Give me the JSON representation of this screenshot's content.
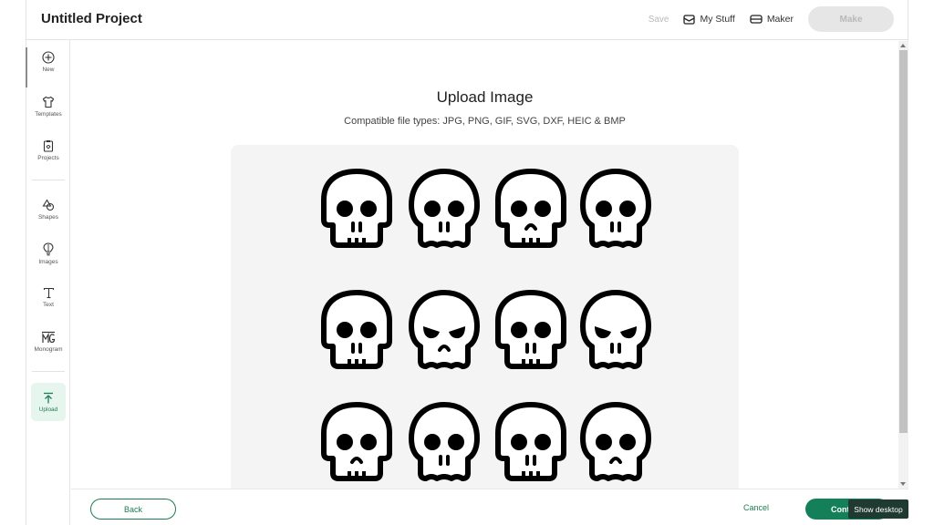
{
  "header": {
    "title": "Untitled Project",
    "save_label": "Save",
    "my_stuff_label": "My Stuff",
    "maker_label": "Maker",
    "make_label": "Make"
  },
  "sidebar": {
    "items": [
      {
        "label": "New",
        "icon": "plus-circle-icon"
      },
      {
        "label": "Templates",
        "icon": "shirt-icon"
      },
      {
        "label": "Projects",
        "icon": "clipboard-icon"
      },
      {
        "label": "Shapes",
        "icon": "shapes-icon"
      },
      {
        "label": "Images",
        "icon": "lightbulb-icon"
      },
      {
        "label": "Text",
        "icon": "text-icon"
      },
      {
        "label": "Monogram",
        "icon": "monogram-icon"
      },
      {
        "label": "Upload",
        "icon": "upload-icon",
        "active": true
      }
    ]
  },
  "main": {
    "title": "Upload Image",
    "subtitle": "Compatible file types:  JPG, PNG, GIF, SVG, DXF, HEIC & BMP",
    "preview": {
      "description": "Uploaded image preview: grid of 12 cartoon skull icons",
      "rows": 3,
      "columns": 4
    }
  },
  "footer": {
    "back_label": "Back",
    "cancel_label": "Cancel",
    "continue_label": "Cont"
  },
  "tooltip": {
    "text": "Show desktop"
  },
  "colors": {
    "accent": "#1c7d52",
    "continue_bg": "#13805a",
    "upload_active_bg": "#e6f5ee",
    "make_disabled_bg": "#e6e6e6",
    "tooltip_bg": "#1f3a30"
  }
}
